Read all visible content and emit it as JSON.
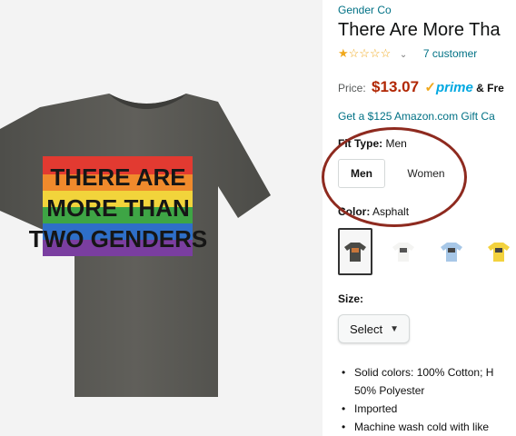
{
  "product": {
    "brand": "Gender Co",
    "title": "There Are More Tha",
    "rating": {
      "stars": "★☆☆☆☆",
      "count_text": "7 customer"
    },
    "price_label": "Price:",
    "price": "$13.07",
    "prime_check": "✓",
    "prime_text": "prime",
    "shipping_text": "& Fre",
    "gift_card_text": "Get a $125 Amazon.com Gift Ca",
    "fit_type": {
      "label": "Fit Type:",
      "value": "Men",
      "options": [
        "Men",
        "Women"
      ]
    },
    "color": {
      "label": "Color:",
      "value": "Asphalt",
      "swatches": [
        {
          "name": "Asphalt",
          "hex": "#4a4a46"
        },
        {
          "name": "White",
          "hex": "#f4f4f2"
        },
        {
          "name": "Baby Blue",
          "hex": "#a7c7e7"
        },
        {
          "name": "Yellow",
          "hex": "#f3d23e"
        }
      ]
    },
    "size": {
      "label": "Size:",
      "select_value": "Select"
    },
    "bullets": [
      "Solid colors: 100% Cotton; H",
      "50% Polyester",
      "Imported",
      "Machine wash cold with like"
    ]
  },
  "shirt_print": {
    "line1": "THERE ARE",
    "line2": "MORE THAN",
    "line3": "TWO GENDERS"
  },
  "colors": {
    "link": "#007185",
    "price": "#b12704",
    "prime": "#00a8e1",
    "star": "#f0a81c",
    "highlight_circle": "#8e2a1f",
    "shirt": "#5a5a55"
  }
}
